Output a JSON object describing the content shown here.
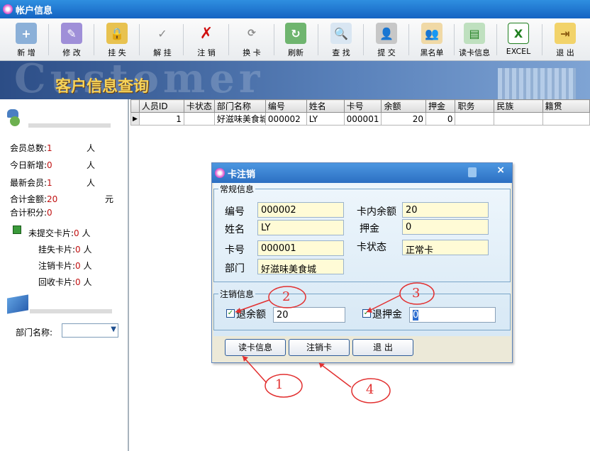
{
  "window": {
    "title": "帐户信息"
  },
  "toolbar": {
    "buttons": [
      {
        "label": "新 增"
      },
      {
        "label": "修 改"
      },
      {
        "label": "挂 失"
      },
      {
        "label": "解 挂"
      },
      {
        "label": "注 销"
      },
      {
        "label": "换 卡"
      },
      {
        "label": "刷新"
      },
      {
        "label": "查 找"
      },
      {
        "label": "提 交"
      },
      {
        "label": "黑名单"
      },
      {
        "label": "读卡信息"
      },
      {
        "label": "EXCEL"
      },
      {
        "label": "退 出"
      }
    ]
  },
  "banner": {
    "bg_text": "Customer",
    "title": "客户信息查询"
  },
  "stats": {
    "member_total_label": "会员总数:",
    "member_total_value": "1",
    "member_total_unit": "人",
    "today_new_label": "今日新增:",
    "today_new_value": "0",
    "today_new_unit": "人",
    "latest_member_label": "最新会员:",
    "latest_member_value": "1",
    "latest_member_unit": "人",
    "total_amount_label": "合计金额:",
    "total_amount_value": "20",
    "total_amount_unit": "元",
    "total_points_label": "合计积分:",
    "total_points_value": "0",
    "unsubmitted_label": "未提交卡片:",
    "unsubmitted_value": "0",
    "unsubmitted_unit": "人",
    "lost_label": "挂失卡片:",
    "lost_value": "0",
    "lost_unit": "人",
    "cancelled_label": "注销卡片:",
    "cancelled_value": "0",
    "cancelled_unit": "人",
    "recycled_label": "回收卡片:",
    "recycled_value": "0",
    "recycled_unit": "人",
    "dept_label": "部门名称:",
    "dept_value": ""
  },
  "grid": {
    "columns": [
      "人员ID",
      "卡状态",
      "部门名称",
      "编号",
      "姓名",
      "卡号",
      "余额",
      "押金",
      "职务",
      "民族",
      "籍贯"
    ],
    "rows": [
      {
        "id": "1",
        "card_status": "",
        "dept": "好滋味美食城",
        "number": "000002",
        "name": "LY",
        "card_no": "000001",
        "balance": "20",
        "deposit": "0",
        "job": "",
        "ethnic": "",
        "native": ""
      }
    ]
  },
  "dialog": {
    "title": "卡注销",
    "general_legend": "常规信息",
    "number_label": "编号",
    "number_value": "000002",
    "name_label": "姓名",
    "name_value": "LY",
    "card_no_label": "卡号",
    "card_no_value": "000001",
    "dept_label": "部门",
    "dept_value": "好滋味美食城",
    "balance_label": "卡内余额",
    "balance_value": "20",
    "deposit_label": "押金",
    "deposit_value": "0",
    "card_status_label": "卡状态",
    "card_status_value": "正常卡",
    "cancel_legend": "注销信息",
    "refund_balance_label": "退余额",
    "refund_balance_value": "20",
    "refund_balance_checked": true,
    "refund_deposit_label": "退押金",
    "refund_deposit_value": "0",
    "refund_deposit_checked": true,
    "read_card_button": "读卡信息",
    "cancel_card_button": "注销卡",
    "exit_button": "退 出"
  },
  "annotations": {
    "a1": "1",
    "a2": "2",
    "a3": "3",
    "a4": "4"
  }
}
